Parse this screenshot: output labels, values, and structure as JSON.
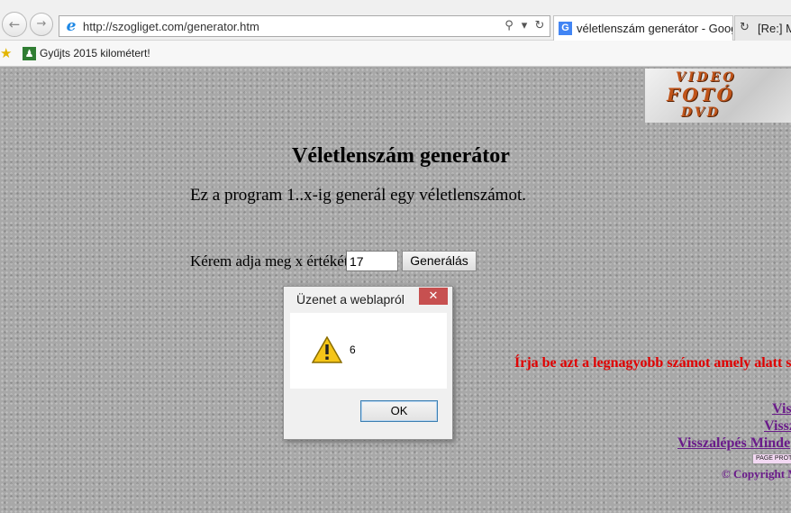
{
  "browser": {
    "nav": {
      "back_icon": "back-arrow-icon",
      "forward_icon": "forward-arrow-icon",
      "back_glyph": "←",
      "forward_glyph": "→"
    },
    "address_bar": {
      "url": "http://szogliget.com/generator.htm",
      "search_glyph": "⚲",
      "dropdown_glyph": "▾",
      "refresh_glyph": "↻"
    },
    "tabs": [
      {
        "title": "véletlenszám generátor - Goog...",
        "favicon": "G",
        "active": true
      },
      {
        "title": "[Re:] Me",
        "favicon": "loading-spinner-icon",
        "active": false
      }
    ],
    "favorites_bar": {
      "star_glyph": "★",
      "runner_glyph": "♟",
      "items": [
        {
          "label": "Gyűjts 2015 kilométert!"
        }
      ]
    }
  },
  "page": {
    "logo": {
      "line1": "VIDEO",
      "line2": "FOTÓ",
      "line3": "DVD"
    },
    "heading": "Véletlenszám generátor",
    "intro": "Ez a program 1..x-ig generál egy véletlenszámot.",
    "form": {
      "prompt": "Kérem adja meg x értékét:",
      "input_value": "17",
      "button_label": "Generálás"
    },
    "red_note": "Írja be azt a legnagyobb számot amely alatt s",
    "links": [
      "Vis",
      "Vissz",
      "Visszalépés Minde"
    ],
    "page_protect": "PAGE PROTECTED",
    "copyright": "© Copyright M"
  },
  "dialog": {
    "title": "Üzenet a weblapról",
    "close_glyph": "✕",
    "message": "6",
    "ok_label": "OK",
    "icon": "warning-icon"
  },
  "colors": {
    "close_button": "#c75050",
    "red_note": "#e00000",
    "link": "#6a1b8a",
    "page_bg": "#a8a8a8"
  }
}
